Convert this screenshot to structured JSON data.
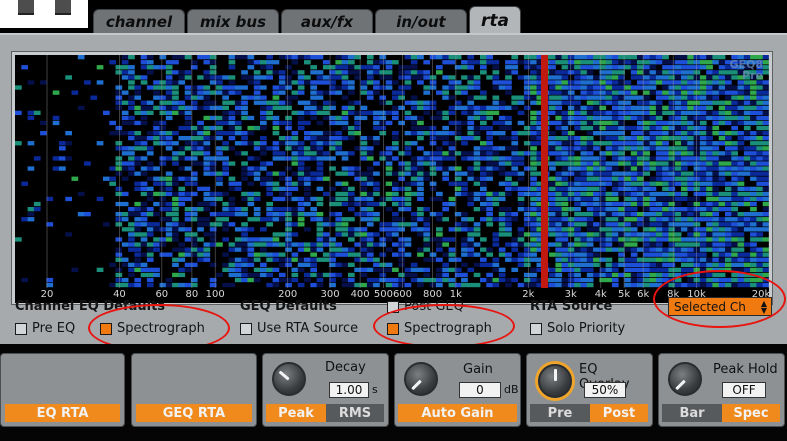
{
  "tabs": [
    {
      "label": "channel",
      "active": false
    },
    {
      "label": "mix bus",
      "active": false
    },
    {
      "label": "aux/fx",
      "active": false
    },
    {
      "label": "in/out",
      "active": false
    },
    {
      "label": "rta",
      "active": true
    }
  ],
  "display": {
    "watermark_line1": "GEQ8",
    "watermark_line2": "Pre",
    "freq_labels": [
      "20",
      "40",
      "60",
      "80",
      "100",
      "200",
      "300",
      "400",
      "500",
      "600",
      "800",
      "1k",
      "2k",
      "3k",
      "4k",
      "5k",
      "6k",
      "8k",
      "10k",
      "20k"
    ]
  },
  "channel_eq": {
    "heading": "Channel EQ Defaults",
    "pre_eq_label": "Pre EQ",
    "pre_eq_checked": false,
    "spectrograph_label": "Spectrograph",
    "spectrograph_checked": true
  },
  "geq": {
    "heading": "GEQ Defaults",
    "post_geq_label": "Post GEQ",
    "post_geq_checked": false,
    "use_rta_source_label": "Use RTA Source",
    "use_rta_source_checked": false,
    "spectrograph_label": "Spectrograph",
    "spectrograph_checked": true
  },
  "rta_source": {
    "heading": "RTA Source",
    "solo_priority_label": "Solo Priority",
    "solo_priority_checked": false,
    "selected_value": "Selected Ch"
  },
  "bottom": {
    "eq_rta_label": "EQ RTA",
    "geq_rta_label": "GEQ RTA",
    "decay": {
      "title": "Decay",
      "value": "1.00",
      "unit": "s",
      "peak_label": "Peak",
      "rms_label": "RMS"
    },
    "gain": {
      "title": "Gain",
      "value": "0",
      "unit": "dB",
      "auto_gain_label": "Auto Gain"
    },
    "eq_overlay": {
      "title": "EQ Overlay",
      "value": "50%",
      "pre_label": "Pre",
      "post_label": "Post"
    },
    "peak_hold": {
      "title": "Peak Hold",
      "value": "OFF",
      "bar_label": "Bar",
      "spec_label": "Spec"
    }
  },
  "colors": {
    "accent_orange": "#f07a10",
    "annotation_red": "#e8140f",
    "spectro_marker": "#c01a10"
  },
  "icons": [
    "knob-decay-icon",
    "knob-gain-icon",
    "knob-eq-overlay-icon",
    "knob-peak-hold-icon",
    "select-arrows-icon"
  ]
}
